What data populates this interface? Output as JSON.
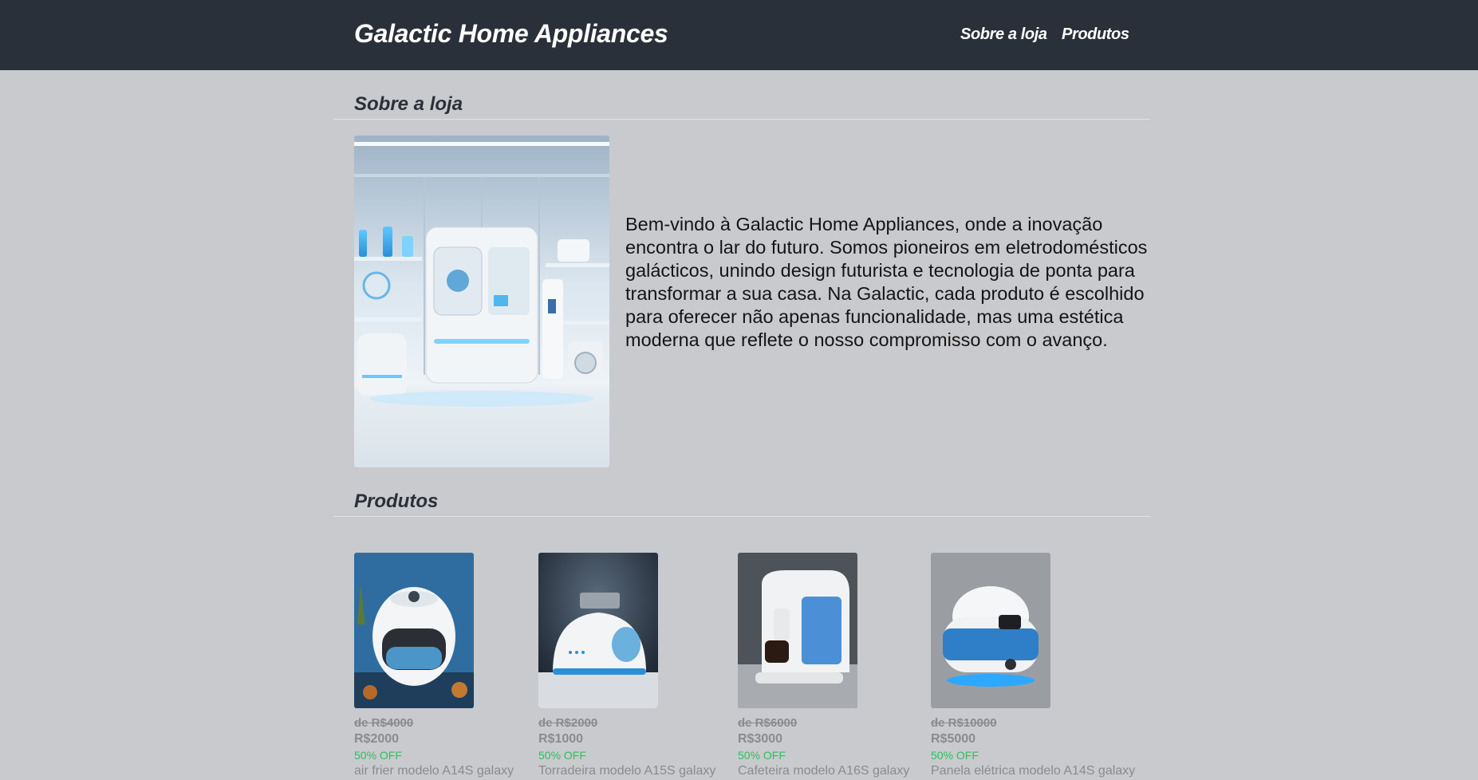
{
  "header": {
    "brand": "Galactic Home Appliances",
    "nav": [
      {
        "label": "Sobre a loja"
      },
      {
        "label": "Produtos"
      }
    ]
  },
  "about": {
    "title": "Sobre a loja",
    "text": "Bem-vindo à Galactic Home Appliances, onde a inovação encontra o lar do futuro. Somos pioneiros em eletrodomésticos galácticos, unindo design futurista e tecnologia de ponta para transformar a sua casa. Na Galactic, cada produto é escolhido para oferecer não apenas funcionalidade, mas uma estética moderna que reflete o nosso compromisso com o avanço."
  },
  "products": {
    "title": "Produtos",
    "items": [
      {
        "old_price": "de R$4000",
        "price": "R$2000",
        "discount": "50% OFF",
        "name": "air frier modelo A14S galaxy"
      },
      {
        "old_price": "de R$2000",
        "price": "R$1000",
        "discount": "50% OFF",
        "name": "Torradeira modelo A15S galaxy"
      },
      {
        "old_price": "de R$6000",
        "price": "R$3000",
        "discount": "50% OFF",
        "name": "Cafeteira modelo A16S galaxy"
      },
      {
        "old_price": "de R$10000",
        "price": "R$5000",
        "discount": "50% OFF",
        "name": "Panela elétrica modelo A14S galaxy"
      }
    ]
  },
  "colors": {
    "header_bg": "#293039",
    "page_bg": "#c9cace",
    "discount": "#2fc05a"
  }
}
